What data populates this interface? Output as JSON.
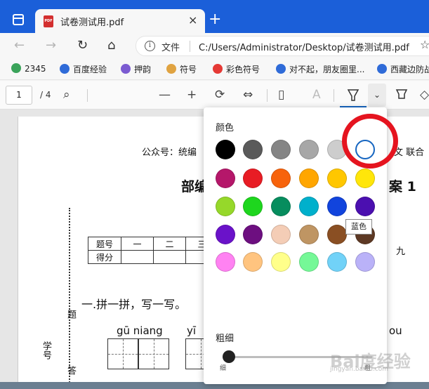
{
  "tab": {
    "title": "试卷测试用.pdf",
    "close": "×",
    "pdf_badge": "PDF",
    "new_tab": "+"
  },
  "nav": {
    "back": "←",
    "forward": "→",
    "refresh": "↻",
    "home": "⌂"
  },
  "address": {
    "info": "i",
    "label": "文件",
    "url": "C:/Users/Administrator/Desktop/试卷测试用.pdf",
    "fav": "☆"
  },
  "bookmarks": [
    {
      "label": "2345",
      "color": "#3aa35a"
    },
    {
      "label": "百度经验",
      "color": "#2f6bd8"
    },
    {
      "label": "押韵",
      "color": "#7b5bd1"
    },
    {
      "label": "符号",
      "color": "#e0a341"
    },
    {
      "label": "彩色符号",
      "color": "#e53935"
    },
    {
      "label": "对不起，朋友圈里...",
      "color": "#2f6bd8"
    },
    {
      "label": "西藏边防战",
      "color": "#2f6bd8"
    }
  ],
  "toolbar": {
    "page": "1",
    "total": "/ 4",
    "search": "⌕",
    "zoom_out": "—",
    "zoom_in": "+",
    "fit": "⇔",
    "read_aloud": "A",
    "chevron": "⌄"
  },
  "document": {
    "header": "公众号：统编",
    "header_right": "文 联合",
    "title_left": "部编",
    "title_right": "案 1",
    "table_row1": [
      "题号",
      "一",
      "二",
      "三"
    ],
    "table_row2": [
      "得分",
      "",
      "",
      ""
    ],
    "table_right": "九",
    "section": "一.拼一拼，写一写。",
    "pinyin_1": "gū  niang",
    "pinyin_2": "yī",
    "pinyin_3": "ou",
    "vert_1": "题",
    "vert_2": "学号",
    "vert_3": "答"
  },
  "popup": {
    "color_label": "颜色",
    "thickness_label": "粗细",
    "thin": "细",
    "thick": "粗",
    "tooltip": "蓝色",
    "colors": [
      [
        "#000000",
        "#5a5a5a",
        "#858585",
        "#a7a7a7",
        "#cdcdcd",
        "#ffffff"
      ],
      [
        "#b5176a",
        "#e81c24",
        "#f7630c",
        "#ffa600",
        "#ffc700",
        "#ffe60a"
      ],
      [
        "#96d82a",
        "#1ed61e",
        "#078d5e",
        "#00b0cc",
        "#1144dd",
        "#4b0fb0"
      ],
      [
        "#6a12c9",
        "#6d0f80",
        "#f4cdb6",
        "#bf9563",
        "#8a4f23",
        "#5d3924"
      ],
      [
        "#ff82f2",
        "#ffc47f",
        "#ffff8a",
        "#75f897",
        "#71d2f8",
        "#bab2f8"
      ]
    ],
    "selected": "#ffffff"
  },
  "watermark": {
    "text": "Bai度经验",
    "sub": "jingyan.baidu.com"
  }
}
